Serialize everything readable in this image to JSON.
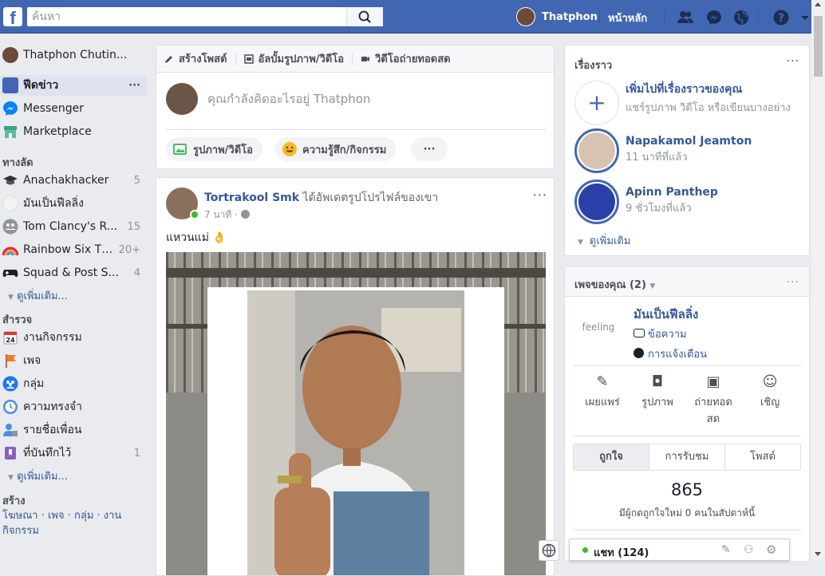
{
  "topbar": {
    "search_placeholder": "ค้นหา",
    "user_name": "Thatphon",
    "home_label": "หน้าหลัก",
    "icons": [
      "friend-requests-icon",
      "messenger-icon",
      "notifications-globe-icon",
      "help-icon",
      "account-menu-icon"
    ],
    "brand_color": "#4267b2"
  },
  "sidebar": {
    "profile_name": "Thatphon Chutin...",
    "main": [
      {
        "label": "ฟีดข่าว",
        "more": "···"
      },
      {
        "label": "Messenger"
      },
      {
        "label": "Marketplace"
      }
    ],
    "shortcuts_title": "ทางลัด",
    "shortcuts": [
      {
        "label": "Anachakhacker",
        "count": "5"
      },
      {
        "label": "มันเป็นฟีลลิ่ง",
        "count": ""
      },
      {
        "label": "Tom Clancy's R...",
        "count": "15"
      },
      {
        "label": "Rainbow Six Th...",
        "count": "20+"
      },
      {
        "label": "Squad & Post S...",
        "count": "4"
      }
    ],
    "shortcuts_more": "ดูเพิ่มเติม...",
    "explore_title": "สำรวจ",
    "explore": [
      {
        "label": "งานกิจกรรม",
        "count": ""
      },
      {
        "label": "เพจ",
        "count": ""
      },
      {
        "label": "กลุ่ม",
        "count": ""
      },
      {
        "label": "ความทรงจำ",
        "count": ""
      },
      {
        "label": "รายชื่อเพื่อน",
        "count": ""
      },
      {
        "label": "ที่บันทึกไว้",
        "count": "1"
      }
    ],
    "explore_more": "ดูเพิ่มเติม...",
    "create_title": "สร้าง",
    "create_links": "โฆษณา · เพจ · กลุ่ม · งาน",
    "create_links2": "กิจกรรม"
  },
  "composer": {
    "tabs": [
      "สร้างโพสต์",
      "อัลบั้มรูปภาพ/วิดีโอ",
      "วิดีโอถ่ายทอดสด"
    ],
    "placeholder": "คุณกำลังคิดอะไรอยู่ Thatphon",
    "buttons": [
      "รูปภาพ/วิดีโอ",
      "ความรู้สึก/กิจกรรม"
    ],
    "more": "···"
  },
  "post": {
    "author": "Tortrakool Smk",
    "action": " ได้อัพเดตรูปโปรไฟล์ของเขา",
    "time": "7 นาที · ",
    "text": "แหวนแม่ 👌",
    "more": "···"
  },
  "stories": {
    "title": "เรื่องราว",
    "more": "···",
    "add_title": "เพิ่มไปที่เรื่องราวของคุณ",
    "add_sub": "แชร์รูปภาพ วิดีโอ หรือเขียนบางอย่าง",
    "items": [
      {
        "name": "Napakamol Jeamton",
        "time": "11 นาทีที่แล้ว"
      },
      {
        "name": "Apinn Panthep",
        "time": "9 ชั่วโมงที่แล้ว"
      }
    ],
    "see_more": "ดูเพิ่มเติม"
  },
  "pages": {
    "title": "เพจของคุณ (2)",
    "more": "···",
    "page_name": "มันเป็นฟีลลิ่ง",
    "page_logo_text": "feeling",
    "links": [
      "ข้อความ",
      "การแจ้งเตือน"
    ],
    "actions": [
      "เผยแพร่",
      "รูปภาพ",
      "ถ่ายทอด\nสด",
      "เชิญ"
    ],
    "tabs": [
      "ถูกใจ",
      "การรับชม",
      "โพสต์"
    ],
    "likes": "865",
    "likes_sub": "มีผู้กดถูกใจใหม่ 0 คนในสัปดาห์นี้"
  },
  "chat": {
    "label": "แชท (124)"
  }
}
